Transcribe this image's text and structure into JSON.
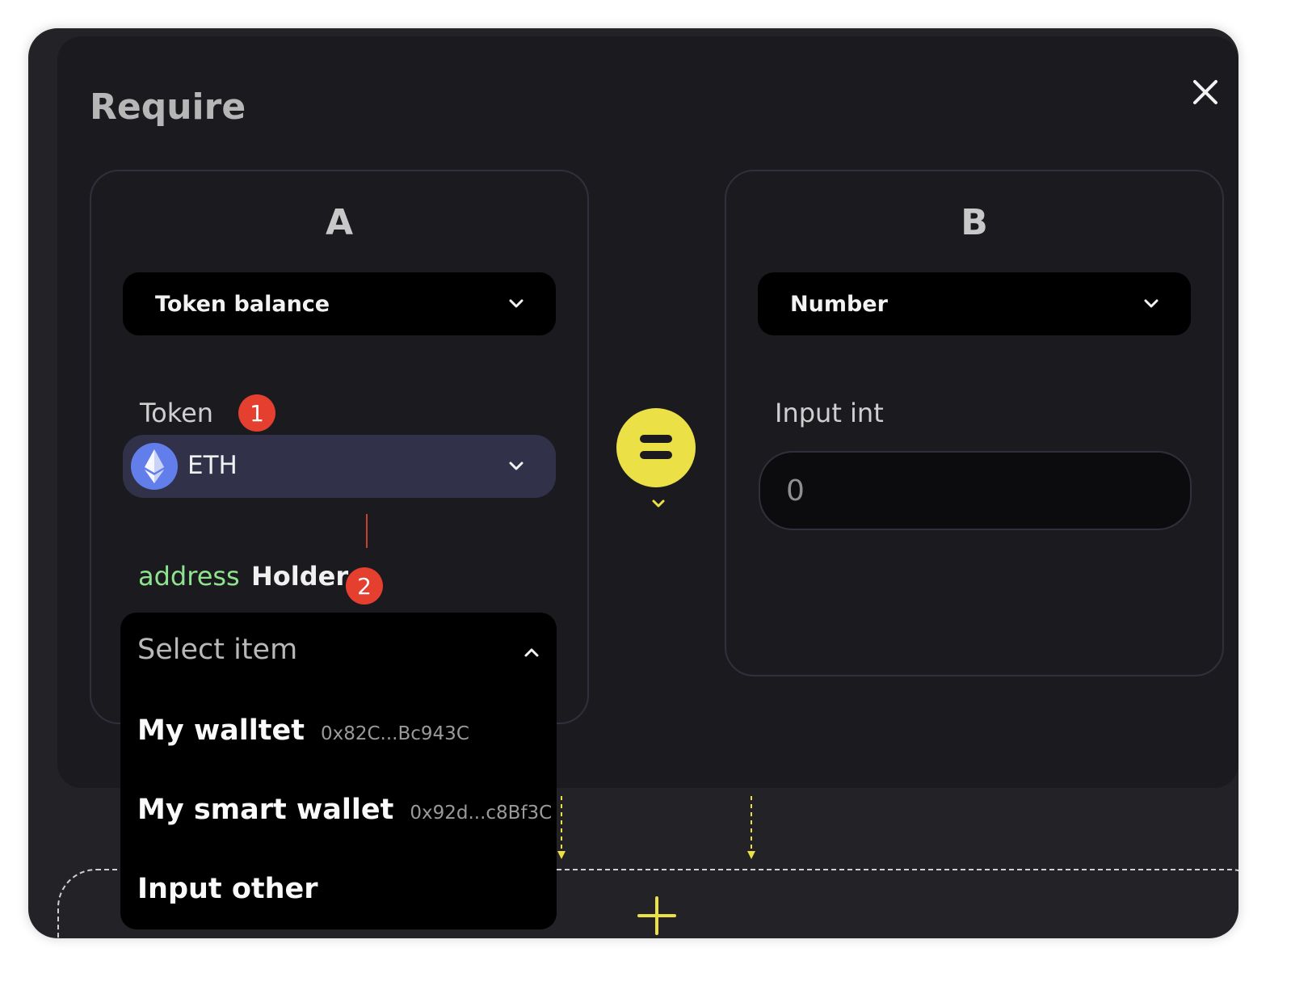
{
  "modal": {
    "title": "Require",
    "close_icon": "close-icon"
  },
  "panel_a": {
    "letter": "A",
    "type_select": "Token balance",
    "token_label": "Token",
    "token_badge": "1",
    "token_value": "ETH",
    "token_icon": "ethereum-icon",
    "holder_type": "address",
    "holder_label": "Holder",
    "holder_badge": "2"
  },
  "operator": {
    "symbol": "=",
    "icon": "equals-icon"
  },
  "panel_b": {
    "letter": "B",
    "type_select": "Number",
    "input_label": "Input int",
    "input_placeholder": "0"
  },
  "dropdown": {
    "placeholder": "Select item",
    "items": [
      {
        "label": "My walltet",
        "address": "0x82C...Bc943C"
      },
      {
        "label": "My smart wallet",
        "address": "0x92d...c8Bf3C"
      },
      {
        "label": "Input other",
        "address": ""
      }
    ]
  },
  "colors": {
    "accent_yellow": "#ebe147",
    "badge_red": "#e53f2f",
    "address_green": "#8ee38e",
    "token_bg": "#31324a"
  }
}
